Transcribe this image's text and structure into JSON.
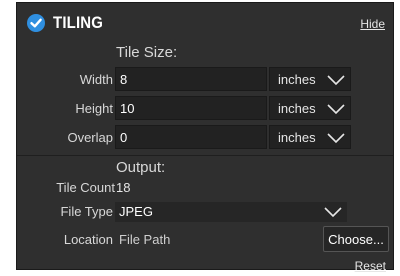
{
  "header": {
    "title": "TILING",
    "hide_label": "Hide",
    "accent_color": "#2f8fe0"
  },
  "tile_size": {
    "heading": "Tile Size:",
    "rows": [
      {
        "label": "Width",
        "value": "8",
        "unit": "inches"
      },
      {
        "label": "Height",
        "value": "10",
        "unit": "inches"
      },
      {
        "label": "Overlap",
        "value": "0",
        "unit": "inches"
      }
    ]
  },
  "output": {
    "heading": "Output:",
    "tile_count_label": "Tile Count",
    "tile_count_value": "18",
    "file_type_label": "File Type",
    "file_type_value": "JPEG",
    "location_label": "Location",
    "location_value": "File Path",
    "choose_label": "Choose..."
  },
  "footer": {
    "reset_label": "Reset"
  }
}
